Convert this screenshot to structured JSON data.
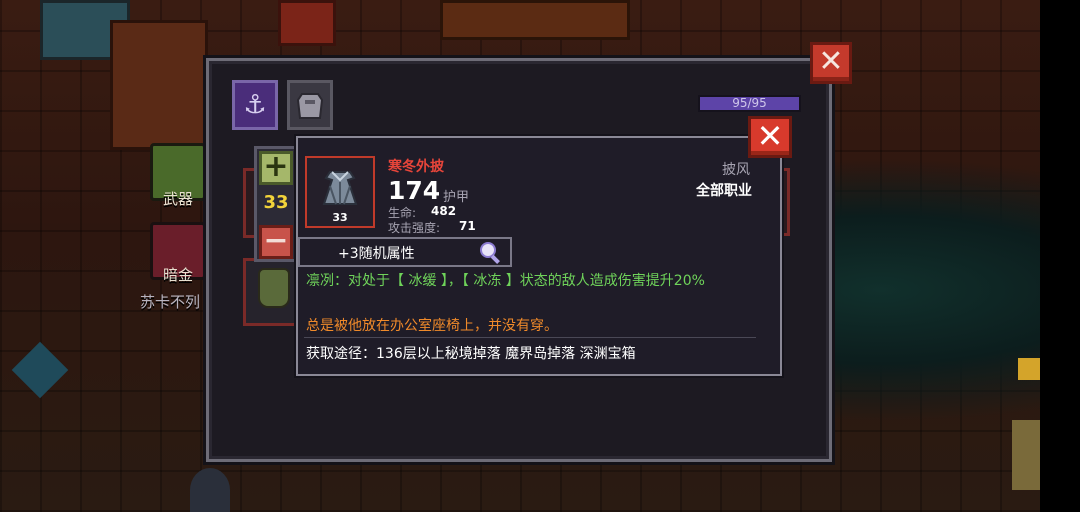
{
  "background": {
    "category_labels": [
      "武器",
      "暗金"
    ],
    "npc_name": "苏卡不列"
  },
  "panel": {
    "tabs": [
      {
        "name": "hook-tab",
        "icon": "anchor-icon"
      },
      {
        "name": "armor-tab",
        "icon": "cloak-icon"
      }
    ],
    "hp": {
      "current": 95,
      "max": 95,
      "text": "95/95"
    }
  },
  "stepper": {
    "quantity": "33",
    "plus_icon": "plus-icon",
    "minus_icon": "minus-icon"
  },
  "item": {
    "name": "寒冬外披",
    "level": "33",
    "armor_value": "174",
    "armor_label": "护甲",
    "stats": [
      {
        "label": "生命:",
        "value": "482"
      },
      {
        "label": "攻击强度:",
        "value": "71"
      }
    ],
    "type": "披风",
    "classes": "全部职业",
    "random_attributes": "+3随机属性",
    "effect": "凛冽：对处于【 冰缓 】，【 冰冻 】状态的敌人造成伤害提升20%",
    "flavor": "总是被他放在办公室座椅上，并没有穿。",
    "source": "获取途径：136层以上秘境掉落 魔界岛掉落 深渊宝箱"
  },
  "colors": {
    "item_name": "#e8453a",
    "effect_text": "#6fd35a",
    "flavor_text": "#f08a2a",
    "quantity": "#f2d33a",
    "close_button": "#d83a2c"
  }
}
